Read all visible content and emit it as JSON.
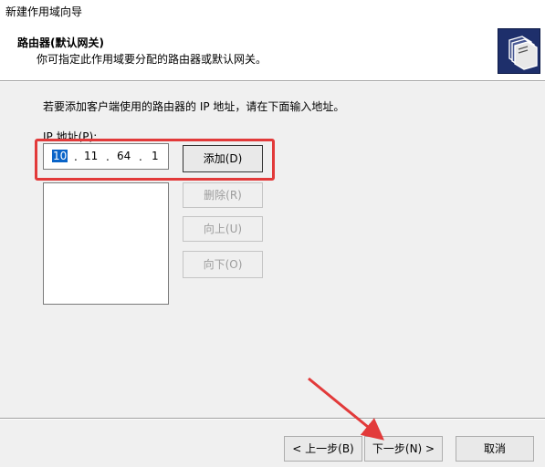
{
  "window": {
    "title": "新建作用域向导"
  },
  "header": {
    "title": "路由器(默认网关)",
    "subtitle": "你可指定此作用域要分配的路由器或默认网关。"
  },
  "body": {
    "instruction": "若要添加客户端使用的路由器的 IP 地址，请在下面输入地址。",
    "ip_label": "IP 地址(P):",
    "ip_octets": [
      "10",
      "11",
      "64",
      "1"
    ],
    "ip_dot": ".",
    "router_list": []
  },
  "buttons": {
    "add": "添加(D)",
    "remove": "删除(R)",
    "up": "向上(U)",
    "down": "向下(O)"
  },
  "footer": {
    "back": "< 上一步(B)",
    "next": "下一步(N) >",
    "cancel": "取消"
  },
  "colors": {
    "annotation": "#e23a3a",
    "selection": "#0a64c8",
    "wizard_icon": "#1e2f6b"
  }
}
